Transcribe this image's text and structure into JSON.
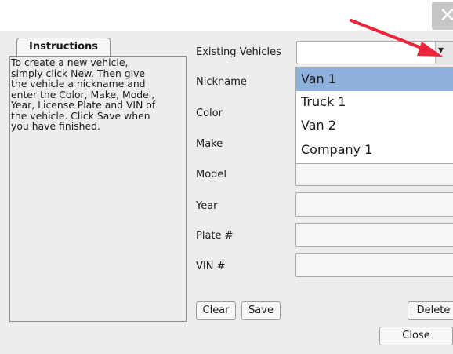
{
  "window": {
    "close_icon": "close-icon"
  },
  "instructions": {
    "tab_label": "Instructions",
    "text": "To create a new vehicle,\nsimply click New. Then give\nthe vehicle a nickname and\nenter the Color, Make, Model,\nYear, License Plate and VIN of\nthe vehicle. Click Save when\nyou have finished."
  },
  "form": {
    "existing_label": "Existing Vehicles",
    "existing_selected": "",
    "nickname_label": "Nickname",
    "color_label": "Color",
    "make_label": "Make",
    "model_label": "Model",
    "year_label": "Year",
    "plate_label": "Plate #",
    "vin_label": "VIN #"
  },
  "dropdown": {
    "options": [
      "Van 1",
      "Truck 1",
      "Van 2",
      "Company 1"
    ],
    "highlighted": "Van 1"
  },
  "buttons": {
    "clear": "Clear",
    "save": "Save",
    "delete": "Delete",
    "close": "Close"
  },
  "annotation": {
    "arrow_color": "#e8253a"
  },
  "colors": {
    "selection": "#8eb0dd",
    "panel": "#ededed"
  }
}
